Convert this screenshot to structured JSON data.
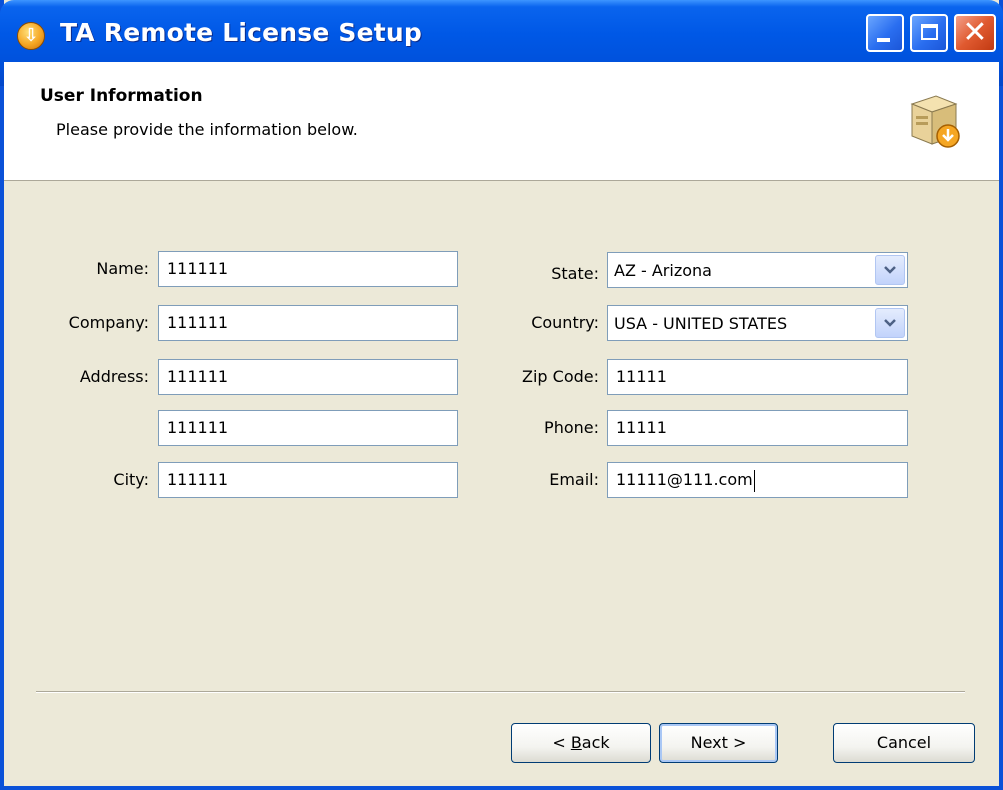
{
  "window": {
    "title": "TA Remote License Setup"
  },
  "header": {
    "title": "User Information",
    "subtitle": "Please provide the information below.",
    "icon": "setup-box-icon"
  },
  "form": {
    "left": [
      {
        "label": "Name:",
        "value": "111111"
      },
      {
        "label": "Company:",
        "value": "111111"
      },
      {
        "label": "Address:",
        "value": "111111"
      },
      {
        "label": "",
        "value": "111111"
      },
      {
        "label": "City:",
        "value": "111111"
      }
    ],
    "state": {
      "label": "State:",
      "value": "AZ - Arizona"
    },
    "country": {
      "label": "Country:",
      "value": "USA - UNITED STATES"
    },
    "zip": {
      "label": "Zip Code:",
      "value": "11111"
    },
    "phone": {
      "label": "Phone:",
      "value": "11111"
    },
    "email": {
      "label": "Email:",
      "value": "11111@111.com"
    }
  },
  "buttons": {
    "back_prefix": "< ",
    "back_accel": "B",
    "back_rest": "ack",
    "next": "Next >",
    "cancel": "Cancel"
  },
  "colors": {
    "titlebar": "#0058e6",
    "dialog_bg": "#ece9d8",
    "field_border": "#7f9db9"
  }
}
